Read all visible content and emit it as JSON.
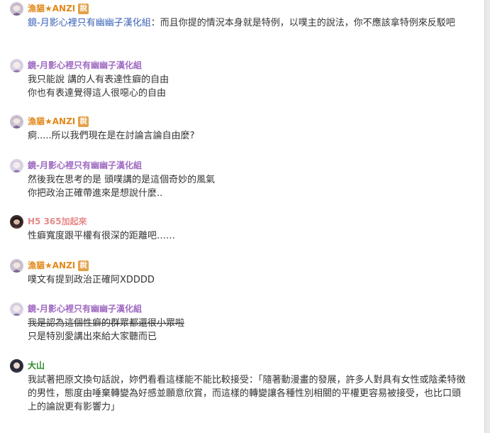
{
  "colors": {
    "name_anzi": "#e08a1c",
    "name_kyo": "#a06bc2",
    "name_h5": "#e5898a",
    "name_dashan": "#2b8a2b",
    "reply_link": "#3a62b7",
    "badge": "#e2a24a"
  },
  "badge_label": "說",
  "comments": [
    {
      "name": "漁貓★ANZI",
      "has_badge": true,
      "reply_to": "鏡-月影心裡只有幽幽子漢化組",
      "lines": [
        "：而且你提的情況本身就是特例，以噗主的說法，你不應該拿特例來反駁吧"
      ]
    },
    {
      "name": "鏡-月影心裡只有幽幽子漢化組",
      "has_badge": false,
      "lines": [
        "我只能說 講的人有表達性癖的自由",
        "你也有表達覺得這人很噁心的自由"
      ]
    },
    {
      "name": "漁貓★ANZI",
      "has_badge": true,
      "lines": [
        "痾.....所以我們現在是在討論言論自由麼?"
      ]
    },
    {
      "name": "鏡-月影心裡只有幽幽子漢化組",
      "has_badge": false,
      "lines": [
        "然後我在思考的是 頭噗講的是這個奇妙的風氣",
        "你把政治正確帶進來是想說什麼.."
      ]
    },
    {
      "name": "H5 365加起來",
      "has_badge": false,
      "lines": [
        "性癖寬度跟平權有很深的距離吧……"
      ]
    },
    {
      "name": "漁貓★ANZI",
      "has_badge": true,
      "lines": [
        "噗文有提到政治正確阿XDDDD"
      ]
    },
    {
      "name": "鏡-月影心裡只有幽幽子漢化組",
      "has_badge": false,
      "lines": [
        "我是認為這個性癖的群眾都還很小眾啦",
        "只是特別愛講出來給大家聽而已"
      ]
    },
    {
      "name": "大山",
      "has_badge": false,
      "lines": [
        "我試著把原文換句話說，妳們看看這樣能不能比較接受：「隨著動漫畫的發展，許多人對具有女性或陰柔特徵的男性，態度由唾棄轉變為好感並願意欣賞，而這樣的轉變讓各種性別相關的平權更容易被接受，也比口頭上的論說更有影響力」"
      ]
    }
  ]
}
